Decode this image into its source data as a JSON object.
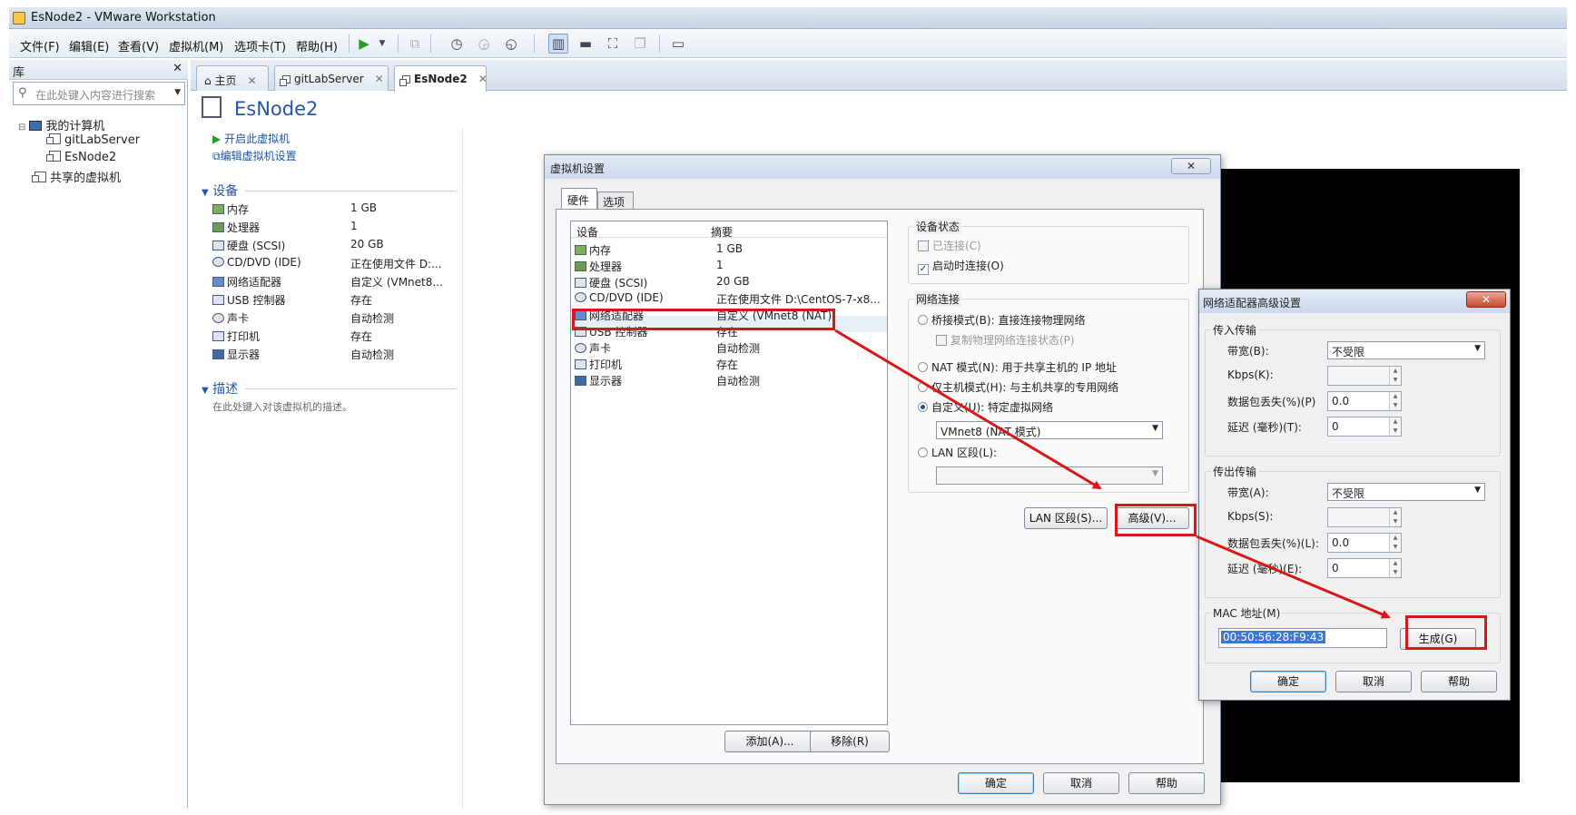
{
  "window": {
    "title": "EsNode2 - VMware Workstation"
  },
  "menu": [
    "文件(F)",
    "编辑(E)",
    "查看(V)",
    "虚拟机(M)",
    "选项卡(T)",
    "帮助(H)"
  ],
  "toolbar_icons": [
    "play-icon",
    "dropdown-icon",
    "send-keys-icon",
    "snapshot-icon",
    "revert-snapshot-icon",
    "snapshot-manager-icon",
    "library-view-icon",
    "thumbnail-bar-icon",
    "fullscreen-icon",
    "unity-icon",
    "console-view-icon"
  ],
  "library": {
    "title": "库",
    "close": "✕",
    "search_placeholder": "在此处键入内容进行搜索",
    "tree": [
      {
        "label": "我的计算机"
      },
      {
        "label": "gitLabServer"
      },
      {
        "label": "EsNode2"
      },
      {
        "label": "共享的虚拟机"
      }
    ]
  },
  "tabs": [
    {
      "label": "主页"
    },
    {
      "label": "gitLabServer"
    },
    {
      "label": "EsNode2"
    }
  ],
  "vm": {
    "name": "EsNode2",
    "actions": [
      "开启此虚拟机",
      "编辑虚拟机设置"
    ],
    "devices_header": "设备",
    "devices": [
      {
        "name": "内存",
        "value": "1 GB"
      },
      {
        "name": "处理器",
        "value": "1"
      },
      {
        "name": "硬盘 (SCSI)",
        "value": "20 GB"
      },
      {
        "name": "CD/DVD (IDE)",
        "value": "正在使用文件 D:..."
      },
      {
        "name": "网络适配器",
        "value": "自定义 (VMnet8..."
      },
      {
        "name": "USB 控制器",
        "value": "存在"
      },
      {
        "name": "声卡",
        "value": "自动检测"
      },
      {
        "name": "打印机",
        "value": "存在"
      },
      {
        "name": "显示器",
        "value": "自动检测"
      }
    ],
    "desc_header": "描述",
    "desc_placeholder": "在此处键入对该虚拟机的描述。"
  },
  "settings_dialog": {
    "title": "虚拟机设置",
    "tabs": [
      "硬件",
      "选项"
    ],
    "col_device": "设备",
    "col_summary": "摘要",
    "rows": [
      {
        "name": "内存",
        "value": "1 GB"
      },
      {
        "name": "处理器",
        "value": "1"
      },
      {
        "name": "硬盘 (SCSI)",
        "value": "20 GB"
      },
      {
        "name": "CD/DVD (IDE)",
        "value": "正在使用文件 D:\\CentOS-7-x8..."
      },
      {
        "name": "网络适配器",
        "value": "自定义 (VMnet8 (NAT)"
      },
      {
        "name": "USB 控制器",
        "value": "存在"
      },
      {
        "name": "声卡",
        "value": "自动检测"
      },
      {
        "name": "打印机",
        "value": "存在"
      },
      {
        "name": "显示器",
        "value": "自动检测"
      }
    ],
    "add_btn": "添加(A)...",
    "remove_btn": "移除(R)",
    "device_status": "设备状态",
    "connected": "已连接(C)",
    "connect_on_power": "启动时连接(O)",
    "net_conn": "网络连接",
    "bridged": "桥接模式(B): 直接连接物理网络",
    "replicate": "复制物理网络连接状态(P)",
    "nat": "NAT 模式(N): 用于共享主机的 IP 地址",
    "hostonly": "仅主机模式(H): 与主机共享的专用网络",
    "custom": "自定义(U): 特定虚拟网络",
    "custom_value": "VMnet8 (NAT 模式)",
    "lan": "LAN 区段(L):",
    "lan_btn": "LAN 区段(S)...",
    "advanced_btn": "高级(V)...",
    "ok": "确定",
    "cancel": "取消",
    "help": "帮助",
    "close": "✕"
  },
  "advanced_dialog": {
    "title": "网络适配器高级设置",
    "close": "✕",
    "incoming": "传入传输",
    "bandwidth_in": "带宽(B):",
    "bandwidth_in_val": "不受限",
    "kbps_in": "Kbps(K):",
    "loss_in": "数据包丢失(%)(P)",
    "loss_in_val": "0.0",
    "lat_in": "延迟 (毫秒)(T):",
    "lat_in_val": "0",
    "outgoing": "传出传输",
    "bandwidth_out": "带宽(A):",
    "bandwidth_out_val": "不受限",
    "kbps_out": "Kbps(S):",
    "loss_out": "数据包丢失(%)(L):",
    "loss_out_val": "0.0",
    "lat_out": "延迟 (毫秒)(E):",
    "lat_out_val": "0",
    "mac_label": "MAC 地址(M)",
    "mac_value": "00:50:56:28:F9:43",
    "generate_btn": "生成(G)",
    "ok": "确定",
    "cancel": "取消",
    "help": "帮助"
  },
  "colors": {
    "annotation_red": "#d81818",
    "accent_blue": "#2456a8"
  }
}
